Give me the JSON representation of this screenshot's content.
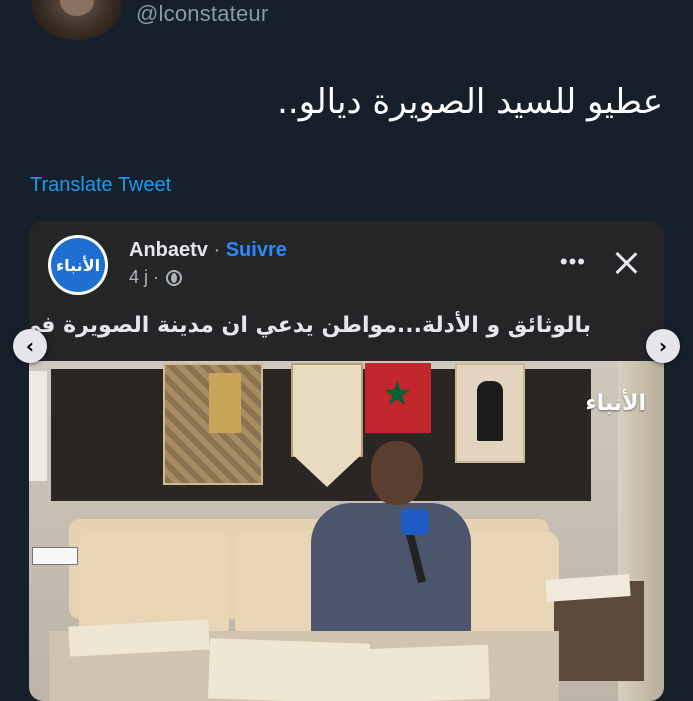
{
  "tweet": {
    "handle": "@lconstateur",
    "text": "عطيو للسيد الصويرة ديالو..",
    "translate_label": "Translate Tweet"
  },
  "embed": {
    "logo_text": "الأنباء",
    "page_name": "Anbaetv",
    "separator": "·",
    "follow_label": "Suivre",
    "time": "4 j ·",
    "more_label": "•••",
    "headline": "بالوثائق و الأدلة...مواطن يدعي ان مدينة الصويرة في ملكيته",
    "video_watermark": "الأنباء",
    "prev_label": "‹",
    "next_label": "›"
  },
  "colors": {
    "background": "#15202b",
    "accent": "#1d9bf0",
    "card": "#242526",
    "follow": "#2d88ff"
  }
}
